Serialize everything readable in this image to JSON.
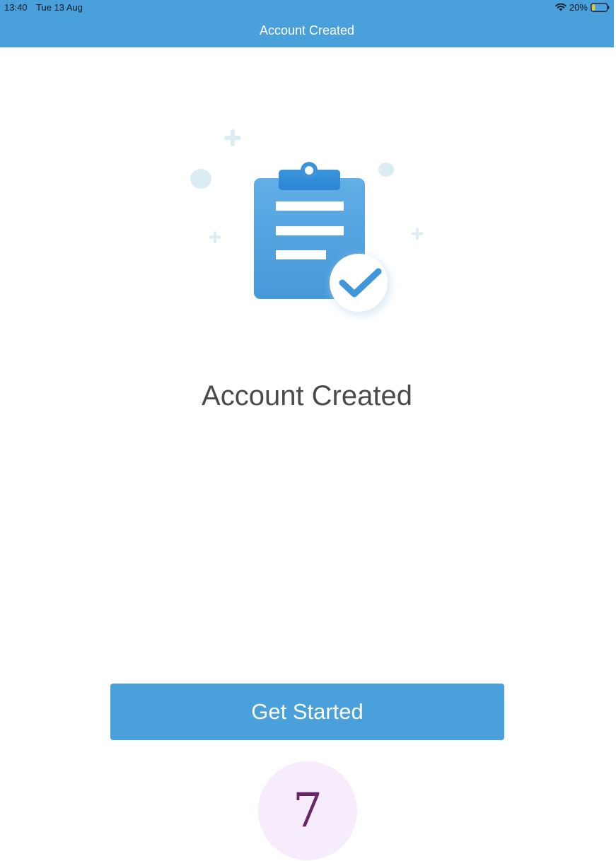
{
  "status_bar": {
    "time": "13:40",
    "date": "Tue 13 Aug",
    "battery_percent": "20%",
    "battery_level": 0.2,
    "icons": [
      "wifi-icon",
      "battery-icon"
    ]
  },
  "nav": {
    "title": "Account Created"
  },
  "illustration": {
    "icon": "clipboard-check-icon"
  },
  "main": {
    "headline": "Account Created",
    "primary_button_label": "Get Started"
  },
  "step_badge": {
    "number": "7"
  },
  "colors": {
    "brand": "#4aa0db",
    "headline": "#4a4a4a",
    "badge_bg": "#f6ecfb",
    "badge_text": "#6a2468",
    "battery_fill": "#f5c518"
  }
}
